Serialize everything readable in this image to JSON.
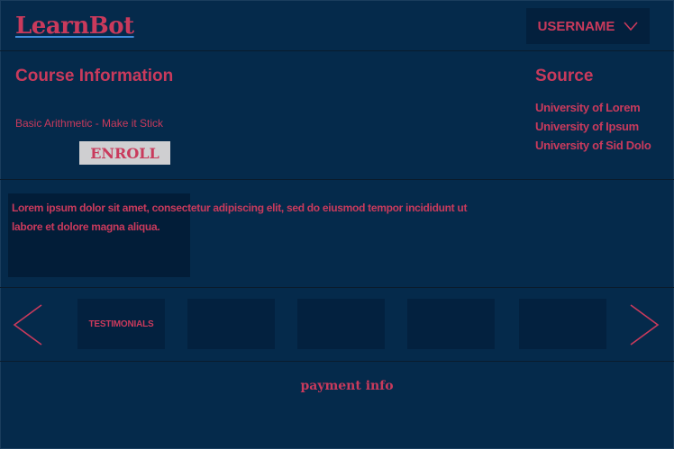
{
  "header": {
    "logo": "LearnBot",
    "username_label": "USERNAME"
  },
  "course": {
    "heading": "Course Information",
    "name": "Basic Arithmetic - Make it Stick",
    "enroll_label": "ENROLL"
  },
  "source": {
    "heading": "Source",
    "items": [
      "University of Lorem",
      "University of Ipsum",
      "University of Sid Dolo"
    ]
  },
  "description": "Lorem ipsum dolor sit amet, consectetur adipiscing elit, sed do eiusmod tempor incididunt ut labore et dolore magna aliqua.",
  "testimonials": {
    "cards": [
      "TESTIMONIALS",
      "",
      "",
      "",
      ""
    ]
  },
  "footer": {
    "payment_label": "payment info"
  },
  "colors": {
    "background": "#052a4b",
    "accent": "#c93a5c",
    "panel": "#03213f"
  }
}
